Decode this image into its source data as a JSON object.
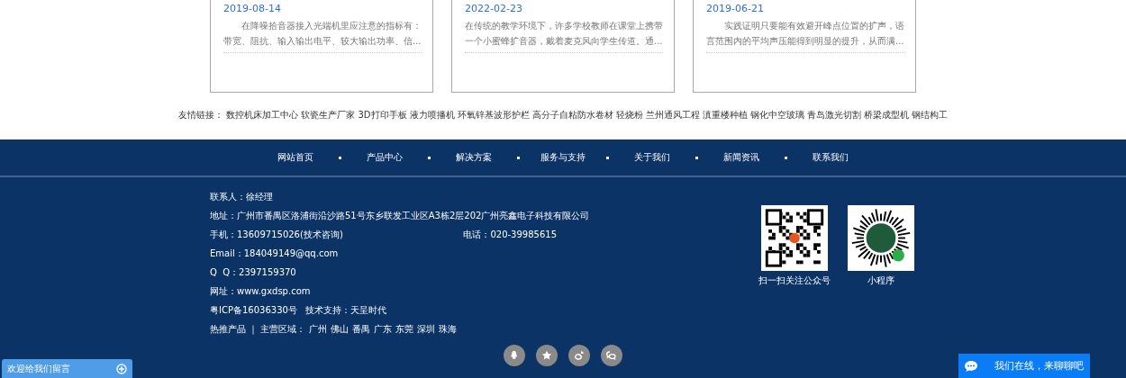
{
  "news": [
    {
      "date": "2019-08-14",
      "excerpt": "在降噪拾音器接入光端机里应注意的指标有：带宽、阻抗、输入输出电平、较大输出功率、信...",
      "indent": true
    },
    {
      "date": "2022-02-23",
      "excerpt": "在传统的教学环境下，许多学校教师在课堂上携带一个小蜜蜂扩音器，戴着麦克风向学生传道。通...",
      "indent": false
    },
    {
      "date": "2019-06-21",
      "excerpt": "实践证明只要能有效避开峰点位置的扩声，语言范围内的平均声压能得到明显的提升，从而满...",
      "indent": true
    }
  ],
  "friend_links": {
    "label": "友情链接：",
    "links": [
      "数控机床加工中心",
      "软瓷生产厂家",
      "3D打印手板",
      "液力喷播机",
      "环氧锌基波形护栏",
      "高分子自粘防水卷材",
      "轻烧粉",
      "兰州通风工程",
      "滇重楼种植",
      "钢化中空玻璃",
      "青岛激光切割",
      "桥梁成型机",
      "钢结构工"
    ]
  },
  "footer_nav": [
    "网站首页",
    "产品中心",
    "解决方案",
    "服务与支持",
    "关于我们",
    "新闻资讯",
    "联系我们"
  ],
  "contact": {
    "lines": [
      "联系人：徐经理",
      "地址：广州市番禺区洛浦街沿沙路51号东乡联发工业区A3栋2层202广州亮鑫电子科技有限公司"
    ],
    "mobile": "手机：13609715026(技术咨询)",
    "phone": "电话：020-39985615",
    "lines2": [
      "Email：184049149@qq.com",
      "Q  Q：2397159370",
      "网址：www.gxdsp.com",
      "粤ICP备16036330号   技术支持：天呈时代"
    ],
    "hot_label": "热推产品 ｜ 主营区域：",
    "regions": [
      "广州",
      "佛山",
      "番禺",
      "广东",
      "东莞",
      "深圳",
      "珠海"
    ]
  },
  "qr_codes": [
    {
      "kind": "qr",
      "caption": "扫一扫关注公众号"
    },
    {
      "kind": "mini",
      "caption": "小程序"
    }
  ],
  "message_tab": {
    "label": "欢迎给我们留言"
  },
  "chat_button": {
    "label": "我们在线，来聊聊吧"
  }
}
